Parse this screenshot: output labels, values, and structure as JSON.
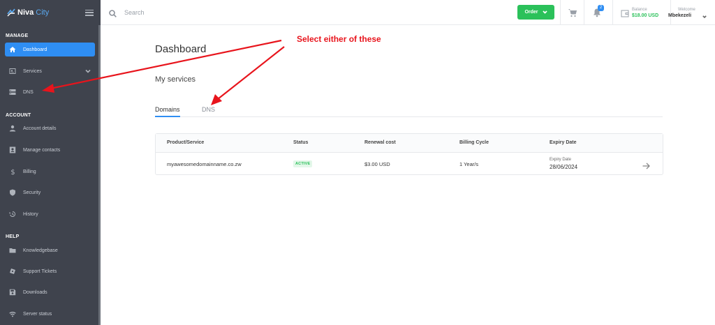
{
  "brand": {
    "name_part1": "Niva",
    "name_part2": "City",
    "accent": "#2f8ef3",
    "sidebar_bg": "#3f434d"
  },
  "sidebar": {
    "sections": [
      {
        "title": "MANAGE"
      },
      {
        "title": "ACCOUNT"
      },
      {
        "title": "HELP"
      }
    ],
    "items": [
      {
        "label": "Dashboard",
        "icon": "home-icon"
      },
      {
        "label": "Services",
        "icon": "services-icon"
      },
      {
        "label": "DNS",
        "icon": "server-icon"
      },
      {
        "label": "Account details",
        "icon": "user-icon"
      },
      {
        "label": "Manage contacts",
        "icon": "contacts-icon"
      },
      {
        "label": "Billing",
        "icon": "dollar-icon"
      },
      {
        "label": "Security",
        "icon": "shield-icon"
      },
      {
        "label": "History",
        "icon": "history-icon"
      },
      {
        "label": "Knowledgebase",
        "icon": "folder-icon"
      },
      {
        "label": "Support Tickets",
        "icon": "ticket-icon"
      },
      {
        "label": "Downloads",
        "icon": "save-icon"
      },
      {
        "label": "Server status",
        "icon": "wifi-icon"
      }
    ]
  },
  "topbar": {
    "search_placeholder": "Search",
    "order_label": "Order",
    "notification_count": "2",
    "balance_label": "Balance",
    "balance_value": "$18.00 USD",
    "welcome_label": "Welcome",
    "user_name": "Mbekezeli"
  },
  "main": {
    "title": "Dashboard",
    "section_title": "My services",
    "tabs": [
      {
        "label": "Domains",
        "active": true
      },
      {
        "label": "DNS",
        "active": false
      }
    ],
    "table": {
      "headers": [
        "Product/Service",
        "Status",
        "Renewal cost",
        "Billing Cycle",
        "Expiry Date"
      ],
      "rows": [
        {
          "product": "myawesomedomainname.co.zw",
          "status": "ACTIVE",
          "renewal_cost": "$3.00 USD",
          "billing_cycle": "1 Year/s",
          "expiry_label": "Expiry Date",
          "expiry_date": "28/06/2024"
        }
      ]
    }
  },
  "annotation": {
    "text": "Select either of these",
    "color": "#e8141c"
  }
}
